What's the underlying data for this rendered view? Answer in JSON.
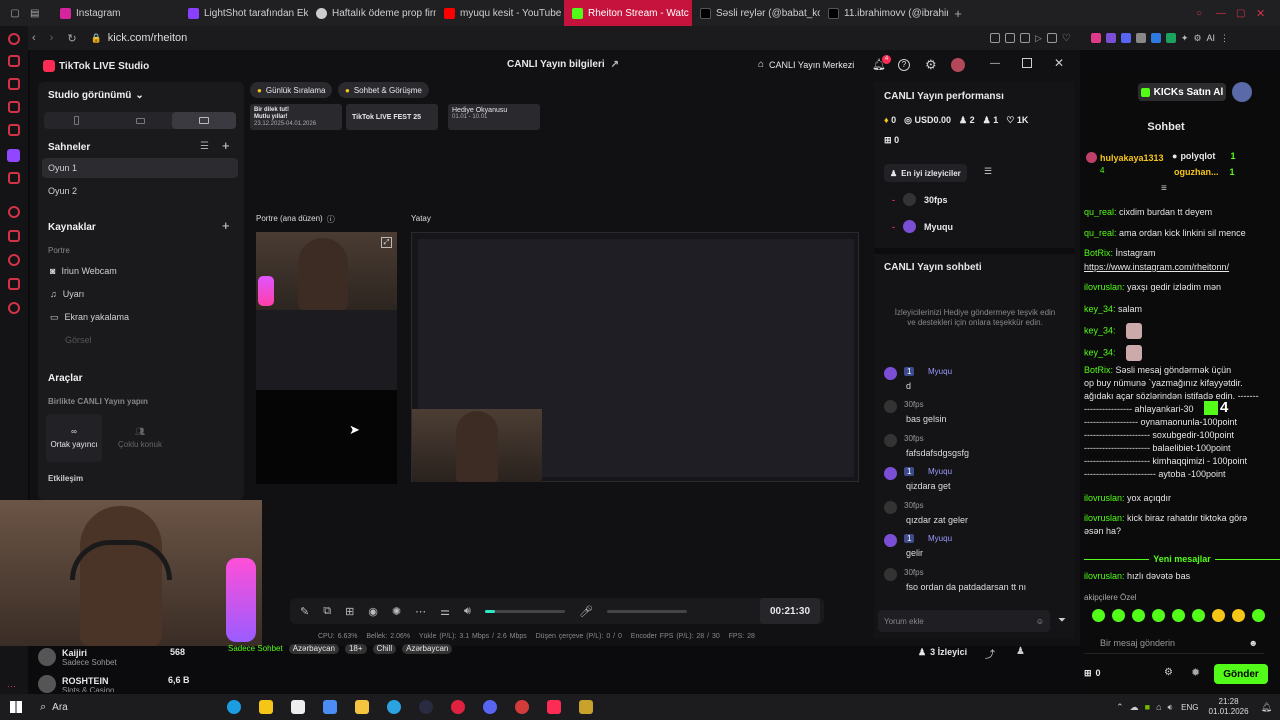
{
  "browser": {
    "tabs": [
      {
        "label": "Instagram",
        "color": "#d6249f"
      },
      {
        "label": "LightShot tarafından Ekra",
        "color": "#8a3ffc"
      },
      {
        "label": "Haftalık ödeme prop firma",
        "color": "#cccccc"
      },
      {
        "label": "myuqu kesit - YouTube",
        "color": "#ff0000"
      },
      {
        "label": "Rheiton Stream - Watc",
        "color": "#53fc18"
      },
      {
        "label": "Səsli reylər (@babat_kom",
        "color": "#222222"
      },
      {
        "label": "11.ibrahimovv (@ibrahimov",
        "color": "#222222"
      }
    ],
    "url": "kick.com/rheiton"
  },
  "studio": {
    "app_title": "TikTok LIVE Studio",
    "center_title": "CANLI Yayın bilgileri",
    "live_center": "CANLI Yayın Merkezi",
    "notif_count": "4",
    "view_label": "Studio görünümü",
    "scenes_title": "Sahneler",
    "scenes": [
      "Oyun 1",
      "Oyun 2"
    ],
    "sources_title": "Kaynaklar",
    "sources_sub": "Portre",
    "sources": [
      "Iriun Webcam",
      "Uyarı",
      "Ekran yakalama",
      "Görsel"
    ],
    "tools_title": "Araçlar",
    "tools_sub": "Birlikte CANLI Yayın yapın",
    "tools": [
      "Ortak yayıncı",
      "Çoklu konuk"
    ],
    "engage": "Etkileşim",
    "chips": [
      "Günlük Sıralama",
      "Sohbet & Görüşme"
    ],
    "banners": [
      {
        "title": "Bir dilek tut!",
        "sub": "Mutlu yıllar!",
        "date": "23.12.2025-04.01.2026"
      },
      {
        "title": "TikTok LIVE FEST 25"
      },
      {
        "title": "Hediye Okyanusu",
        "date": "01.01 - 10.01"
      }
    ],
    "portrait_label": "Portre (ana düzen)",
    "landscape_label": "Yatay",
    "timer": "00:21:30",
    "stats": "CPU: 6.63%   Bellek: 2.06%   Yükle (P/L): 3.1 Mbps / 2.6 Mbps   Düşen çerçeve (P/L): 0 / 0   Encoder FPS (P/L): 28 / 30   FPS: 28",
    "volume_level": 0.12
  },
  "performance": {
    "title": "CANLI Yayın performansı",
    "diamonds": "0",
    "usd": "USD0.00",
    "users": "2",
    "follows": "1",
    "likes": "1K",
    "gifts": "0",
    "top_viewers_tab": "En iyi izleyiciler",
    "top_viewers": [
      "30fps",
      "Myuqu"
    ]
  },
  "live_chat": {
    "title": "CANLI Yayın sohbeti",
    "hint": "İzleyicilerinizi Hediye göndermeye teşvik edin ve destekleri için onlara teşekkür edin.",
    "messages": [
      {
        "user": "Myuqu",
        "text": "d"
      },
      {
        "user": "30fps",
        "text": "bas gelsin"
      },
      {
        "user": "30fps",
        "text": "fafsdafsdgsgsfg"
      },
      {
        "user": "Myuqu",
        "text": "qizdara get"
      },
      {
        "user": "30fps",
        "text": "qızdar zat geler"
      },
      {
        "user": "Myuqu",
        "text": "gelir"
      },
      {
        "user": "30fps",
        "text": "fso ordan da patdadarsan tt nı"
      }
    ],
    "input_placeholder": "Yorum ekle",
    "level_badge": "1"
  },
  "kick": {
    "buy": "KICKs Satın Al",
    "chat_title": "Sohbet",
    "top": [
      {
        "name": "hulyakaya1313",
        "count": "4"
      },
      {
        "name": "polyqlot",
        "count": "1"
      },
      {
        "name": "oguzhan...",
        "count": "1"
      }
    ],
    "lines": [
      {
        "user": "qu_real:",
        "text": " cixdim burdan tt deyem"
      },
      {
        "user": "qu_real:",
        "text": " ama ordan kick linkini sil mence"
      },
      {
        "user": "BotRix:",
        "text": " İnstagram"
      },
      {
        "user": "",
        "text": "https://www.instagram.com/rheitonn/"
      },
      {
        "user": "ilovruslan:",
        "text": " yaxşı gedir izlədim mən"
      },
      {
        "user": "key_34:",
        "text": " salam"
      },
      {
        "user": "key_34:",
        "text": ""
      },
      {
        "user": "key_34:",
        "text": ""
      },
      {
        "user": "BotRix:",
        "text": " Səsli mesaj göndərmək üçün"
      },
      {
        "user": "",
        "text": "op buy nümunə `yazmağınız kifayyətdir."
      },
      {
        "user": "",
        "text": "ağıdakı açar sözlərindən istifadə edin. -------"
      },
      {
        "user": "",
        "text": "---------------- ahlayankari-30"
      },
      {
        "user": "",
        "text": "------------------ oynamaonunla-100point"
      },
      {
        "user": "",
        "text": "---------------------- soxubgedir-100point"
      },
      {
        "user": "",
        "text": "---------------------- balaelibiet-100point"
      },
      {
        "user": "",
        "text": "---------------------- kimhaqqimizi - 100point"
      },
      {
        "user": "",
        "text": "------------------------ aytoba -100point"
      },
      {
        "user": "ilovruslan:",
        "text": " yox açıqdır"
      },
      {
        "user": "ilovruslan:",
        "text": " kick biraz rahatdır tiktoka görə"
      },
      {
        "user": "",
        "text": "əsən ha?"
      }
    ],
    "new_messages": "Yeni mesajlar",
    "last_line": {
      "user": "ilovruslan:",
      "text": " hızlı dəvətə bas"
    },
    "emote_label": "akipçilere Özel",
    "input_placeholder": "Bir mesaj gönderin",
    "send": "Gönder",
    "points": "0",
    "overlay_number": "4"
  },
  "bottom_streams": [
    {
      "name": "Kaijiri",
      "sub": "Sadece Sohbet",
      "viewers": "568"
    },
    {
      "name": "ROSHTEIN",
      "sub": "Slots & Casino",
      "viewers": "6,6 B"
    }
  ],
  "stream_info": {
    "tags": [
      "Sadece Sohbet",
      "Azərbaycan",
      "18+",
      "Chill",
      "Azərbaycan"
    ],
    "viewers": "3 İzleyici"
  },
  "taskbar": {
    "search": "Ara",
    "lang": "ENG",
    "time": "21:28",
    "date": "01.01.2026"
  }
}
